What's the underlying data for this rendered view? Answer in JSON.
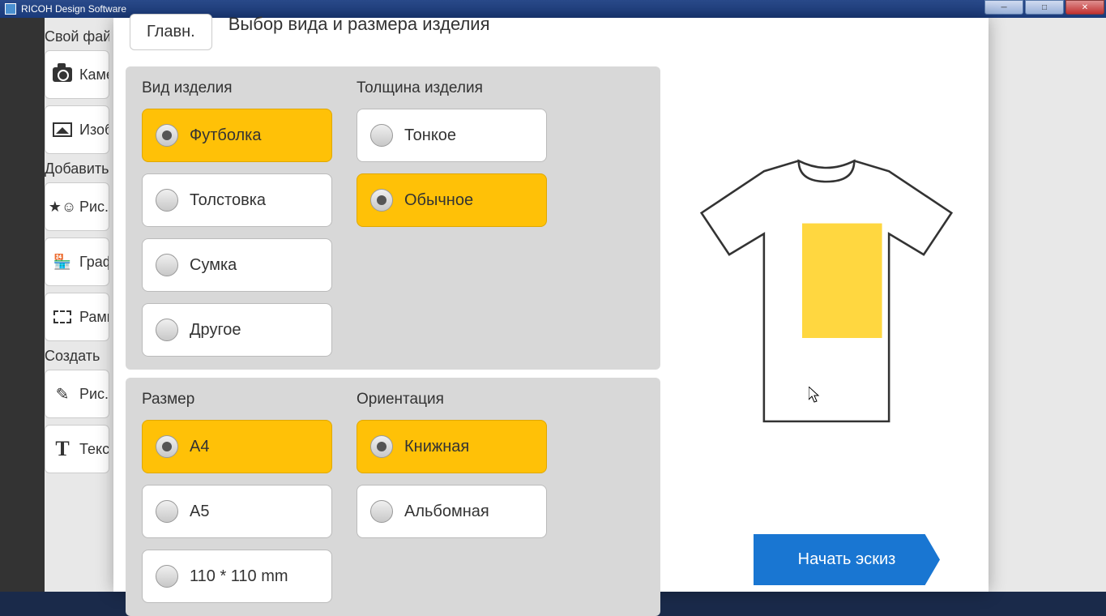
{
  "window": {
    "title": "RICOH Design Software"
  },
  "sidebar": {
    "section1_label": "Свой файл",
    "btn_camera": "Камера",
    "btn_image": "Изображ.",
    "section2_label": "Добавить",
    "btn_clipart": "Рис.",
    "btn_store": "Графика",
    "btn_crop": "Рамка",
    "section3_label": "Создать",
    "btn_pen": "Рис.",
    "btn_text": "Текст"
  },
  "modal": {
    "tab_main": "Главн.",
    "title": "Выбор вида и размера изделия",
    "product_type_heading": "Вид изделия",
    "thickness_heading": "Толщина изделия",
    "size_heading": "Размер",
    "orientation_heading": "Ориентация",
    "product_types": {
      "tshirt": "Футболка",
      "sweatshirt": "Толстовка",
      "bag": "Сумка",
      "other": "Другое"
    },
    "thickness": {
      "thin": "Тонкое",
      "normal": "Обычное"
    },
    "sizes": {
      "a4": "A4",
      "a5": "A5",
      "custom": "110 * 110 mm"
    },
    "orientation": {
      "portrait": "Книжная",
      "landscape": "Альбомная"
    },
    "start_button": "Начать эскиз"
  }
}
